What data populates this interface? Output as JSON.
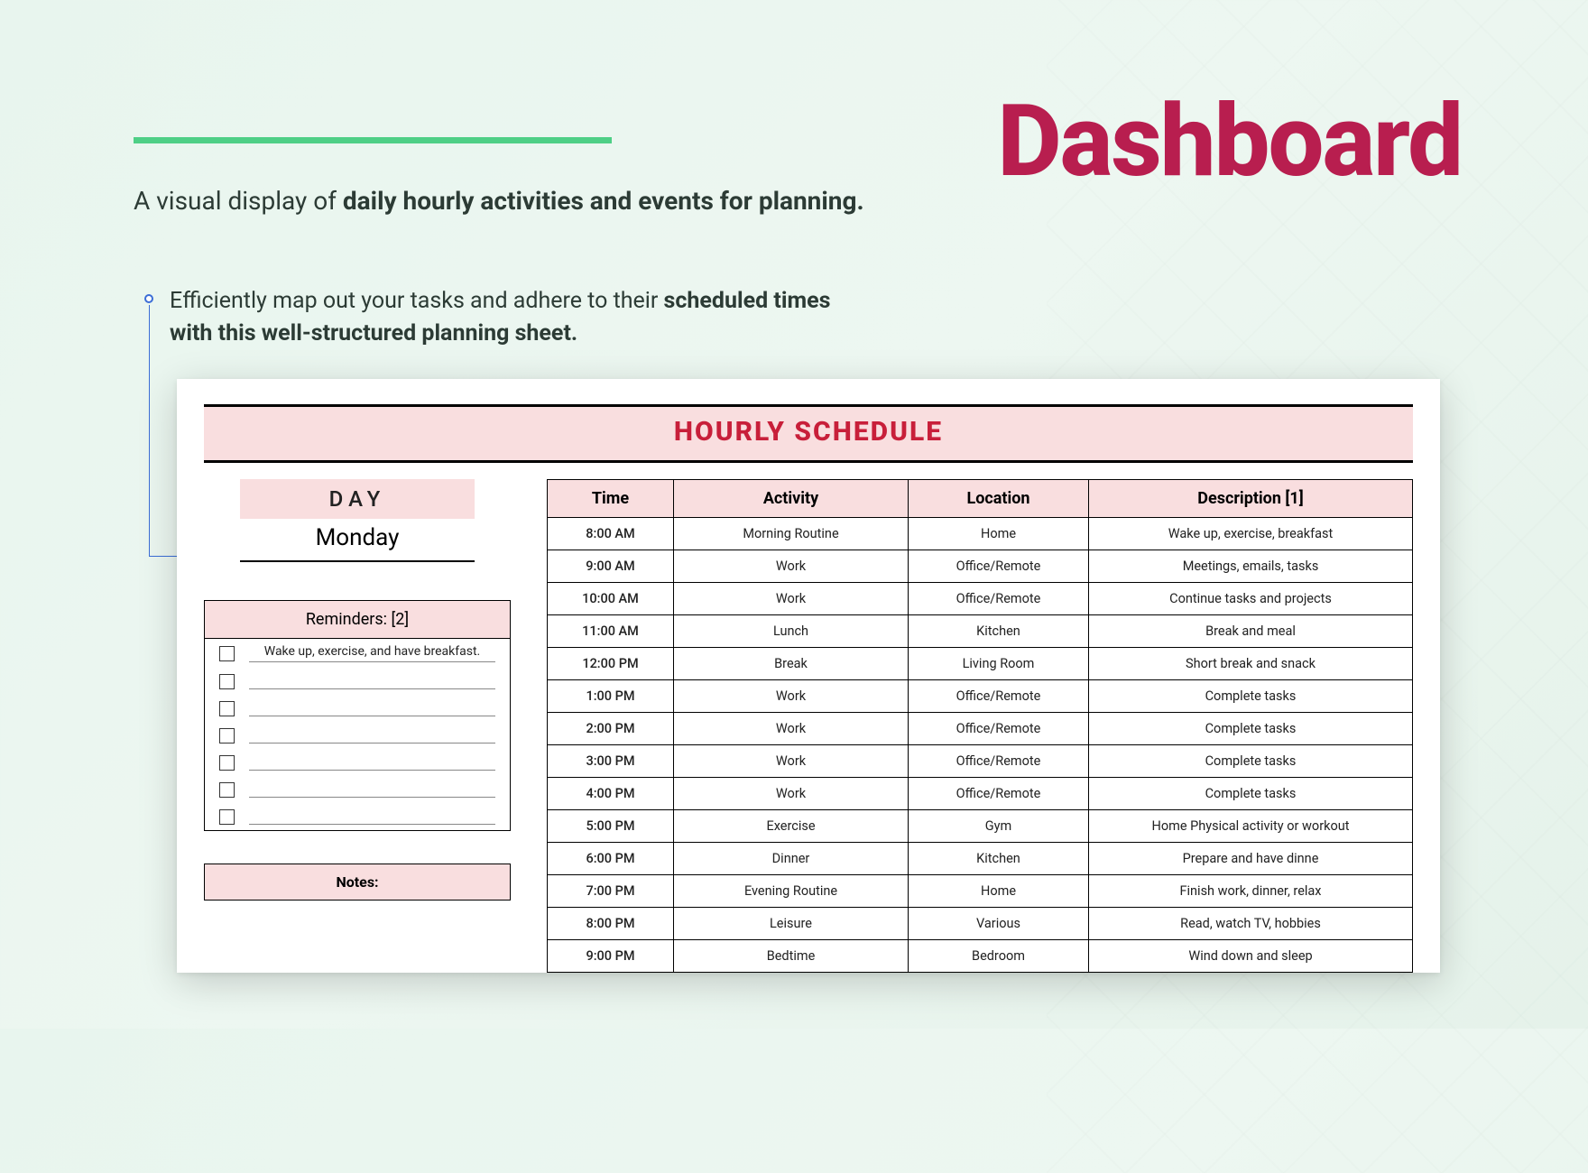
{
  "header": {
    "title": "Dashboard",
    "subtitle_pre": "A visual display of ",
    "subtitle_bold": "daily hourly activities and events for planning."
  },
  "callout": {
    "line1_pre": "Efficiently map out your tasks and adhere to their ",
    "line1_bold": "scheduled times",
    "line2_bold": "with this well-structured planning sheet."
  },
  "sheet": {
    "title": "HOURLY SCHEDULE",
    "day_label": "DAY",
    "day_value": "Monday",
    "reminders_label": "Reminders: [2]",
    "reminders": [
      "Wake up, exercise, and have breakfast.",
      "",
      "",
      "",
      "",
      "",
      ""
    ],
    "notes_label": "Notes:",
    "columns": [
      "Time",
      "Activity",
      "Location",
      "Description [1]"
    ],
    "rows": [
      {
        "time": "8:00 AM",
        "activity": "Morning Routine",
        "location": "Home",
        "desc": "Wake up, exercise, breakfast"
      },
      {
        "time": "9:00 AM",
        "activity": "Work",
        "location": "Office/Remote",
        "desc": "Meetings, emails, tasks"
      },
      {
        "time": "10:00 AM",
        "activity": "Work",
        "location": "Office/Remote",
        "desc": "Continue tasks and projects"
      },
      {
        "time": "11:00 AM",
        "activity": "Lunch",
        "location": "Kitchen",
        "desc": "Break and meal"
      },
      {
        "time": "12:00 PM",
        "activity": "Break",
        "location": "Living Room",
        "desc": "Short break and snack"
      },
      {
        "time": "1:00 PM",
        "activity": "Work",
        "location": "Office/Remote",
        "desc": "Complete tasks"
      },
      {
        "time": "2:00 PM",
        "activity": "Work",
        "location": "Office/Remote",
        "desc": "Complete tasks"
      },
      {
        "time": "3:00 PM",
        "activity": "Work",
        "location": "Office/Remote",
        "desc": "Complete tasks"
      },
      {
        "time": "4:00 PM",
        "activity": "Work",
        "location": "Office/Remote",
        "desc": "Complete tasks"
      },
      {
        "time": "5:00 PM",
        "activity": "Exercise",
        "location": "Gym",
        "desc": "Home Physical activity or workout"
      },
      {
        "time": "6:00 PM",
        "activity": "Dinner",
        "location": "Kitchen",
        "desc": "Prepare and have dinne"
      },
      {
        "time": "7:00 PM",
        "activity": "Evening Routine",
        "location": "Home",
        "desc": "Finish work, dinner, relax"
      },
      {
        "time": "8:00 PM",
        "activity": "Leisure",
        "location": "Various",
        "desc": "Read, watch TV, hobbies"
      },
      {
        "time": "9:00 PM",
        "activity": "Bedtime",
        "location": "Bedroom",
        "desc": "Wind down and sleep"
      }
    ]
  }
}
